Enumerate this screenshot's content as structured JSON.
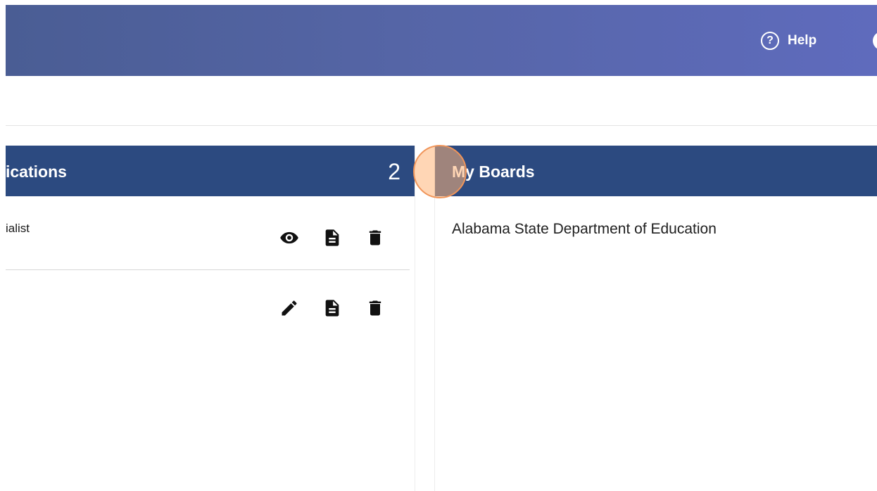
{
  "header": {
    "help_icon": "question-circle-icon",
    "help_label": "Help"
  },
  "applications_panel": {
    "title": "ications",
    "count": "2",
    "rows": [
      {
        "label": "ialist",
        "actions": [
          "eye-icon",
          "document-icon",
          "trash-icon"
        ]
      },
      {
        "label": "",
        "actions": [
          "pencil-icon",
          "document-icon",
          "trash-icon"
        ]
      }
    ]
  },
  "boards_panel": {
    "title": "My Boards",
    "items": [
      "Alabama State Department of Education"
    ]
  },
  "colors": {
    "header_gradient_start": "#4a5d94",
    "header_gradient_end": "#5f6bbd",
    "panel_header": "#2c4a80",
    "click_marker": "#f0955a"
  }
}
